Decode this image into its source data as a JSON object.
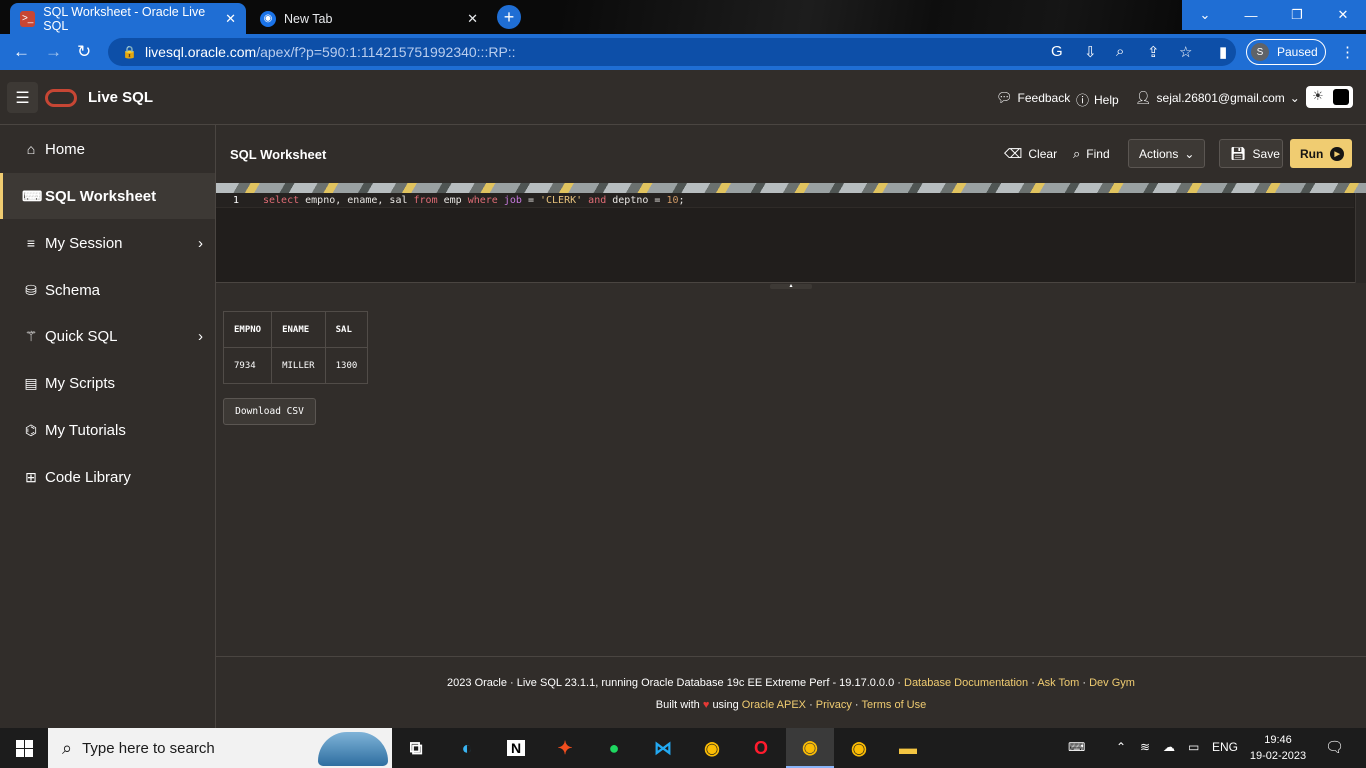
{
  "browser": {
    "tabs": [
      {
        "title": "SQL Worksheet - Oracle Live SQL",
        "active": true
      },
      {
        "title": "New Tab",
        "active": false
      }
    ],
    "url_host": "livesql.oracle.com",
    "url_path": "/apex/f?p=590:1:114215751992340:::RP::",
    "profile_initial": "S",
    "profile_status": "Paused"
  },
  "app": {
    "title": "Live SQL",
    "feedback": "Feedback",
    "help": "Help",
    "user_email": "sejal.26801@gmail.com"
  },
  "sidebar": {
    "items": [
      {
        "label": "Home",
        "icon": "home-icon"
      },
      {
        "label": "SQL Worksheet",
        "icon": "terminal-icon",
        "active": true
      },
      {
        "label": "My Session",
        "icon": "list-icon",
        "has_children": true
      },
      {
        "label": "Schema",
        "icon": "database-icon"
      },
      {
        "label": "Quick SQL",
        "icon": "wand-icon",
        "has_children": true
      },
      {
        "label": "My Scripts",
        "icon": "document-icon"
      },
      {
        "label": "My Tutorials",
        "icon": "graduation-cap-icon"
      },
      {
        "label": "Code Library",
        "icon": "library-icon"
      }
    ]
  },
  "worksheet": {
    "title": "SQL Worksheet",
    "clear": "Clear",
    "find": "Find",
    "actions": "Actions",
    "save": "Save",
    "run": "Run",
    "line_number": "1",
    "code_tokens": [
      {
        "t": "select",
        "c": "kw"
      },
      {
        "t": " empno, ename, sal ",
        "c": "txt"
      },
      {
        "t": "from",
        "c": "kw"
      },
      {
        "t": " emp ",
        "c": "txt"
      },
      {
        "t": "where",
        "c": "kw"
      },
      {
        "t": " ",
        "c": "txt"
      },
      {
        "t": "job",
        "c": "kw2"
      },
      {
        "t": " = ",
        "c": "txt"
      },
      {
        "t": "'CLERK'",
        "c": "str"
      },
      {
        "t": " ",
        "c": "txt"
      },
      {
        "t": "and",
        "c": "kw"
      },
      {
        "t": " deptno = ",
        "c": "txt"
      },
      {
        "t": "10",
        "c": "num"
      },
      {
        "t": ";",
        "c": "txt"
      }
    ]
  },
  "results": {
    "columns": [
      "EMPNO",
      "ENAME",
      "SAL"
    ],
    "rows": [
      [
        "7934",
        "MILLER",
        "1300"
      ]
    ],
    "download_label": "Download CSV"
  },
  "footer": {
    "line1_prefix": "2023 Oracle · Live SQL 23.1.1, running Oracle Database 19c EE Extreme Perf - 19.17.0.0.0 ·",
    "doc_link": "Database Documentation",
    "ask_tom": "Ask Tom",
    "dev_gym": "Dev Gym",
    "built_with": "Built with",
    "using": "using",
    "apex_link": "Oracle APEX",
    "privacy": "Privacy",
    "terms": "Terms of Use",
    "sep": "·"
  },
  "taskbar": {
    "search_placeholder": "Type here to search",
    "language": "ENG",
    "time": "19:46",
    "date": "19-02-2023"
  },
  "colors": {
    "accent": "#f0cc71",
    "oracle_red": "#c74634",
    "chrome_blue": "#1f6ed4",
    "background": "#312d2a"
  }
}
